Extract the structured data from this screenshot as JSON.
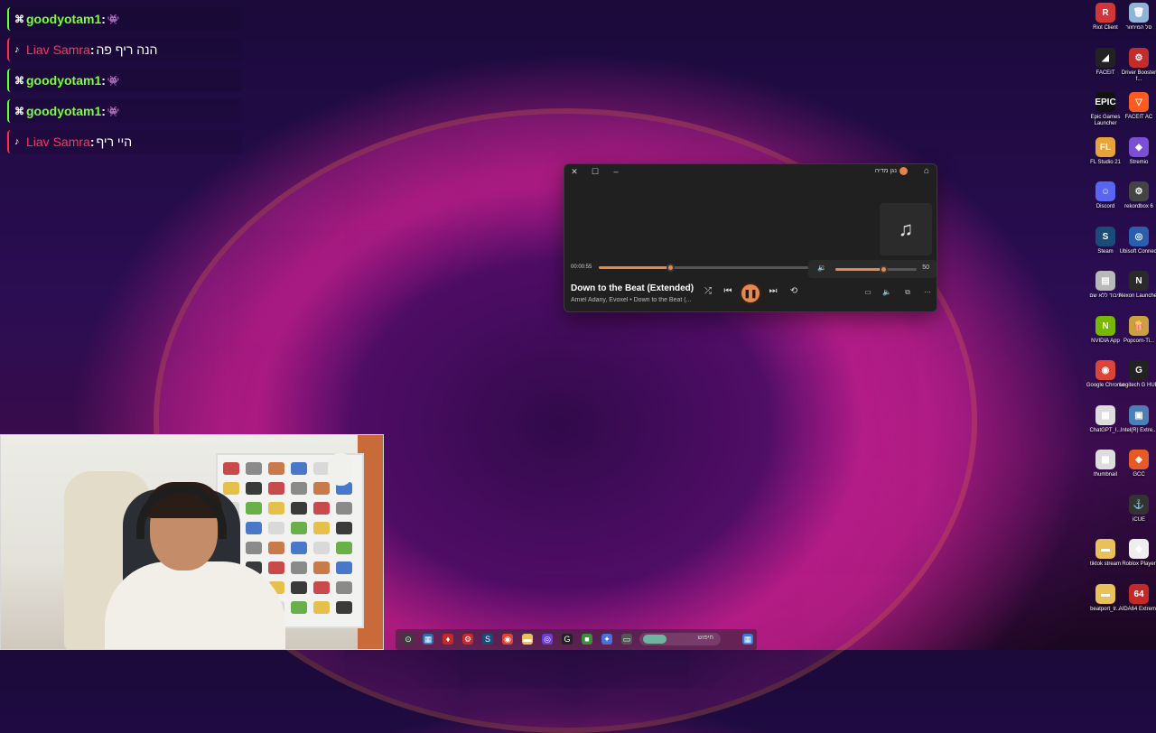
{
  "chat": [
    {
      "platform": "twitch",
      "user": "goodyotam1",
      "text": "",
      "emote": "👾"
    },
    {
      "platform": "tiktok",
      "user": "Liav Samra",
      "text": "הנה ריף פה",
      "emote": ""
    },
    {
      "platform": "twitch",
      "user": "goodyotam1",
      "text": "",
      "emote": "👾"
    },
    {
      "platform": "twitch",
      "user": "goodyotam1",
      "text": "",
      "emote": "👾"
    },
    {
      "platform": "tiktok",
      "user": "Liav Samra",
      "text": "היי ריף",
      "emote": ""
    }
  ],
  "player": {
    "title": "נגן מדיה",
    "time": "00:00:55",
    "progress_fraction": 0.34,
    "volume": "50",
    "volume_fraction": 0.5,
    "song_title": "Down to the Beat (Extended)",
    "song_artist": "Amiel Adany, Evoxel • Down to the Beat (...",
    "icons": {
      "close": "✕",
      "maximize": "☐",
      "minimize": "–",
      "home": "⌂",
      "album": "♫",
      "volume": "🔉",
      "shuffle": "⤮",
      "prev": "⏮",
      "pause": "❚❚",
      "next": "⏭",
      "repeat": "⟲",
      "subtitles": "▭",
      "speaker": "🔈",
      "miniplayer": "⧉",
      "more": "⋯"
    },
    "accent_color": "#e48a4e"
  },
  "desktop_icons": [
    {
      "label": "Riot Client",
      "color": "#d13639",
      "glyph": "R"
    },
    {
      "label": "סל המיחזור",
      "color": "#8fb4d8",
      "glyph": "🗑"
    },
    {
      "label": "FACEIT",
      "color": "#222222",
      "glyph": "◢"
    },
    {
      "label": "Driver Booster f...",
      "color": "#c42b2b",
      "glyph": "⚙"
    },
    {
      "label": "Epic Games Launcher",
      "color": "#111111",
      "glyph": "EPIC"
    },
    {
      "label": "FACEIT AC",
      "color": "#ff5a1f",
      "glyph": "▽"
    },
    {
      "label": "FL Studio 21",
      "color": "#e8a33b",
      "glyph": "FL"
    },
    {
      "label": "Stremio",
      "color": "#7b4ed6",
      "glyph": "◆"
    },
    {
      "label": "Discord",
      "color": "#5865f2",
      "glyph": "☺"
    },
    {
      "label": "rekordbox 6",
      "color": "#444444",
      "glyph": "⚙"
    },
    {
      "label": "Steam",
      "color": "#1b4b78",
      "glyph": "S"
    },
    {
      "label": "Ubisoft Connect",
      "color": "#2a5fb0",
      "glyph": "◎"
    },
    {
      "label": "עיבוד ללא שם",
      "color": "#b8b8b8",
      "glyph": "▤"
    },
    {
      "label": "Nexon Launcher",
      "color": "#2a2a2a",
      "glyph": "N"
    },
    {
      "label": "NVIDIA App",
      "color": "#76b900",
      "glyph": "N"
    },
    {
      "label": "Popcorn-Ti...",
      "color": "#c9a23d",
      "glyph": "🍿"
    },
    {
      "label": "Google Chrome",
      "color": "#db4437",
      "glyph": "◉"
    },
    {
      "label": "Logitech G HUB",
      "color": "#222222",
      "glyph": "G"
    },
    {
      "label": "ChatGPT_I...",
      "color": "#dddddd",
      "glyph": "▦"
    },
    {
      "label": "Intel(R) Extre...",
      "color": "#4a7fb8",
      "glyph": "▣"
    },
    {
      "label": "thumbnail",
      "color": "#dddddd",
      "glyph": "▦"
    },
    {
      "label": "GCC",
      "color": "#e55a25",
      "glyph": "◈"
    },
    {
      "label": "iCUE",
      "color": "#333333",
      "glyph": "⚓"
    },
    {
      "label": "tiktok stream",
      "color": "#e8c15a",
      "glyph": "▬"
    },
    {
      "label": "Roblox Player",
      "color": "#eeeeee",
      "glyph": "◆"
    },
    {
      "label": "beatport_tr...",
      "color": "#e8c15a",
      "glyph": "▬"
    },
    {
      "label": "AIDA64 Extreme",
      "color": "#c62828",
      "glyph": "64"
    }
  ],
  "taskbar": {
    "search_label": "חיפוש",
    "items": [
      {
        "name": "start",
        "glyph": "⊙",
        "color": "#3b3b3b"
      },
      {
        "name": "widgets",
        "glyph": "▦",
        "color": "#2f6fb0"
      },
      {
        "name": "pin-red",
        "glyph": "♦",
        "color": "#c62828"
      },
      {
        "name": "driver",
        "glyph": "⚙",
        "color": "#c42b2b"
      },
      {
        "name": "steam",
        "glyph": "S",
        "color": "#1b4b78"
      },
      {
        "name": "chrome",
        "glyph": "◉",
        "color": "#db4437"
      },
      {
        "name": "explorer",
        "glyph": "▬",
        "color": "#e8c15a"
      },
      {
        "name": "app-purple",
        "glyph": "◎",
        "color": "#6a3fd6"
      },
      {
        "name": "logitech",
        "glyph": "G",
        "color": "#222222"
      },
      {
        "name": "minecraft",
        "glyph": "■",
        "color": "#3c8f3a"
      },
      {
        "name": "copilot",
        "glyph": "✦",
        "color": "#4a6fd6"
      },
      {
        "name": "window",
        "glyph": "▭",
        "color": "#555555"
      },
      {
        "name": "store",
        "glyph": "▦",
        "color": "#3a7bd5"
      }
    ]
  }
}
